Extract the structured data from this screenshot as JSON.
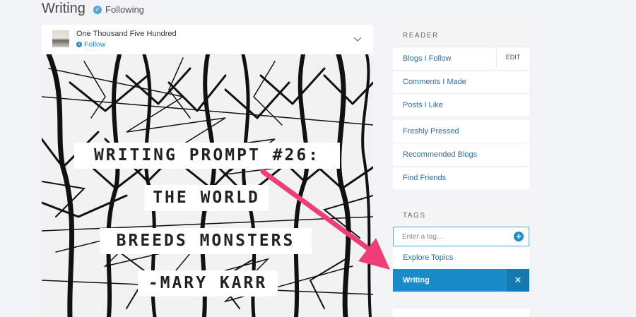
{
  "page": {
    "title": "Writing",
    "following_label": "Following"
  },
  "post": {
    "blog_name": "One Thousand Five Hundred",
    "follow_label": "Follow",
    "image_text_lines": [
      "WRITING PROMPT #26:",
      "THE WORLD",
      "BREEDS MONSTERS",
      "-MARY KARR"
    ]
  },
  "sidebar": {
    "reader_heading": "READER",
    "reader_items": [
      {
        "label": "Blogs I Follow"
      },
      {
        "label": "Comments I Made"
      },
      {
        "label": "Posts I Like"
      }
    ],
    "edit_label": "EDIT",
    "discover_items": [
      {
        "label": "Freshly Pressed"
      },
      {
        "label": "Recommended Blogs"
      },
      {
        "label": "Find Friends"
      }
    ],
    "tags_heading": "TAGS",
    "tag_input_placeholder": "Enter a tag...",
    "explore_label": "Explore Topics",
    "active_tag": "Writing"
  },
  "colors": {
    "accent": "#1a8ac9",
    "link": "#2f6e9e",
    "arrow": "#ee3e76"
  },
  "icons": [
    "check-icon",
    "plus-icon",
    "chevron-down-icon",
    "add-tag-icon",
    "close-icon"
  ]
}
